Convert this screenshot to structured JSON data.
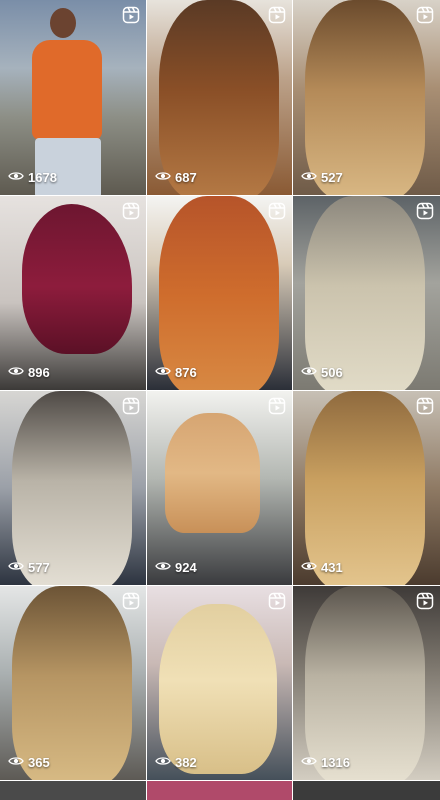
{
  "grid": {
    "tiles": [
      {
        "views": "1678",
        "bg": "linear-gradient(180deg,#7a8ea8 0%,#a6b2bd 35%,#8d8f86 60%,#5e5a50 100%)",
        "subject": "man"
      },
      {
        "views": "687",
        "bg": "linear-gradient(180deg,#e7e3dc 0%,#bca28a 40%,#8a5a34 100%)",
        "hair": "linear-gradient(180deg,#5a3a25 0%,#8a4f27 45%,#b57a45 100%)"
      },
      {
        "views": "527",
        "bg": "linear-gradient(180deg,#d8d2c8 0%,#a98f74 45%,#6f5b48 100%)",
        "hair": "linear-gradient(180deg,#6b4b2d 0%,#b48a58 45%,#d9b884 100%)"
      },
      {
        "views": "896",
        "bg": "linear-gradient(180deg,#e6e2df 0%,#c9c3bf 55%,#3c3a38 100%)",
        "hair": "linear-gradient(180deg,#6d1630 0%,#8d1c3c 55%,#5b1026 100%)",
        "subject": "woman-red"
      },
      {
        "views": "876",
        "bg": "linear-gradient(180deg,#f4f4f2 0%,#d8cbb8 35%,#2b2f38 100%)",
        "hair": "linear-gradient(180deg,#b6542a 0%,#cf6d2d 50%,#d88a44 100%)"
      },
      {
        "views": "506",
        "bg": "linear-gradient(180deg,#5d6367 0%,#a3a39d 45%,#7c7a72 100%)",
        "hair": "linear-gradient(180deg,#8c877d 0%,#cbc3ad 45%,#e2dcc8 100%)"
      },
      {
        "views": "577",
        "bg": "linear-gradient(180deg,#d7d6d3 0%,#9ba0a8 50%,#2d3440 100%)",
        "hair": "linear-gradient(180deg,#4f4a46 0%,#b9b3a7 45%,#e5e0d5 100%)"
      },
      {
        "views": "924",
        "bg": "linear-gradient(180deg,#f2f2ef 0%,#b3b7b2 45%,#3a3b3e 100%)",
        "hair": "linear-gradient(180deg,#d6a572 0%,#e2b885 50%,#c89058 100%)",
        "subject": "bob"
      },
      {
        "views": "431",
        "bg": "linear-gradient(180deg,#c7c0b5 0%,#8f7a64 50%,#4b3b2e 100%)",
        "hair": "linear-gradient(180deg,#8f6a3e 0%,#c9a060 45%,#e4c68f 100%)"
      },
      {
        "views": "365",
        "bg": "linear-gradient(180deg,#e4e6e6 0%,#aab0b1 45%,#5d5a55 100%)",
        "hair": "linear-gradient(180deg,#6c5436 0%,#b69563 45%,#d8bb85 100%)"
      },
      {
        "views": "382",
        "bg": "linear-gradient(180deg,#e8dfe2 0%,#c9b9b5 40%,#45505a 100%)",
        "hair": "linear-gradient(180deg,#e2cfa0 0%,#f0e0b6 45%,#d8bf88 100%)",
        "subject": "blonde-front"
      },
      {
        "views": "1316",
        "bg": "linear-gradient(180deg,#3e3a38 0%,#7b756c 40%,#d3cdc1 100%)",
        "hair": "linear-gradient(180deg,#5b554d 0%,#b9b2a2 45%,#e8e2d2 100%)"
      }
    ],
    "partial_row_colors": [
      "#4a4a4a",
      "#b04a6a",
      "#3b3b3b"
    ]
  },
  "icons": {
    "reel": "reel-icon",
    "views": "eye-icon"
  }
}
